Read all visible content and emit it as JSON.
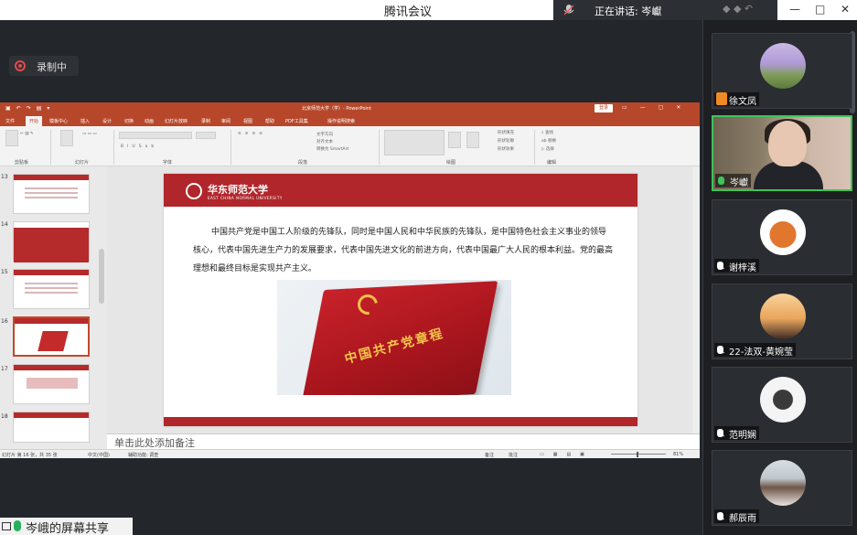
{
  "window": {
    "app_title": "腾讯会议",
    "speaking_prefix": "正在讲话:",
    "speaking_name": "岑巘",
    "controls": [
      "—",
      "□",
      "✕"
    ]
  },
  "recording": {
    "label": "录制中"
  },
  "share": {
    "label": "岑峨的屏幕共享"
  },
  "ppt": {
    "file_title": "北京师范大学（学）- PowerPoint",
    "login": "登录",
    "tabs": [
      "文件",
      "开始",
      "模板中心",
      "插入",
      "设计",
      "切换",
      "动画",
      "幻灯片放映",
      "录制",
      "审阅",
      "视图",
      "帮助",
      "PDF工具集",
      "操作说明搜索"
    ],
    "ribbon_groups": [
      "剪贴板",
      "幻灯片",
      "字体",
      "段落",
      "绘图",
      "编辑"
    ],
    "thumbnail_numbers": [
      "13",
      "14",
      "15",
      "16",
      "17",
      "18"
    ],
    "slide": {
      "university_cn": "华东师范大学",
      "university_en": "EAST CHINA NORMAL UNIVERSITY",
      "body": "中国共产党是中国工人阶级的先锋队，同时是中国人民和中华民族的先锋队，是中国特色社会主义事业的领导核心，代表中国先进生产力的发展要求，代表中国先进文化的前进方向，代表中国最广大人民的根本利益。党的最高理想和最终目标是实现共产主义。",
      "book_title": "中国共产党章程"
    },
    "notes_placeholder": "单击此处添加备注",
    "status": {
      "slide_count": "幻灯片 第 16 张，共 35 张",
      "language": "中文(中国)",
      "accessibility": "辅助功能: 调查",
      "notes_btn": "备注",
      "comments_btn": "批注",
      "zoom": "81%"
    }
  },
  "participants": [
    {
      "name": "徐文凤",
      "kind": "avatar",
      "mic": "person",
      "colors": [
        "#b9a6d9",
        "#6d8f4e"
      ]
    },
    {
      "name": "岑巘",
      "kind": "video",
      "mic": "on"
    },
    {
      "name": "谢梓溪",
      "kind": "avatar",
      "mic": "off",
      "colors": [
        "#ffffff",
        "#e1762e"
      ]
    },
    {
      "name": "22-法双-黄婉莹",
      "kind": "avatar",
      "mic": "off",
      "colors": [
        "#f5c27a",
        "#3b2a24"
      ]
    },
    {
      "name": "范明娴",
      "kind": "avatar",
      "mic": "off",
      "colors": [
        "#f4f4f4",
        "#3a3a3a"
      ]
    },
    {
      "name": "郝辰雨",
      "kind": "avatar",
      "mic": "off",
      "colors": [
        "#cfd6dc",
        "#6e5648"
      ]
    }
  ]
}
